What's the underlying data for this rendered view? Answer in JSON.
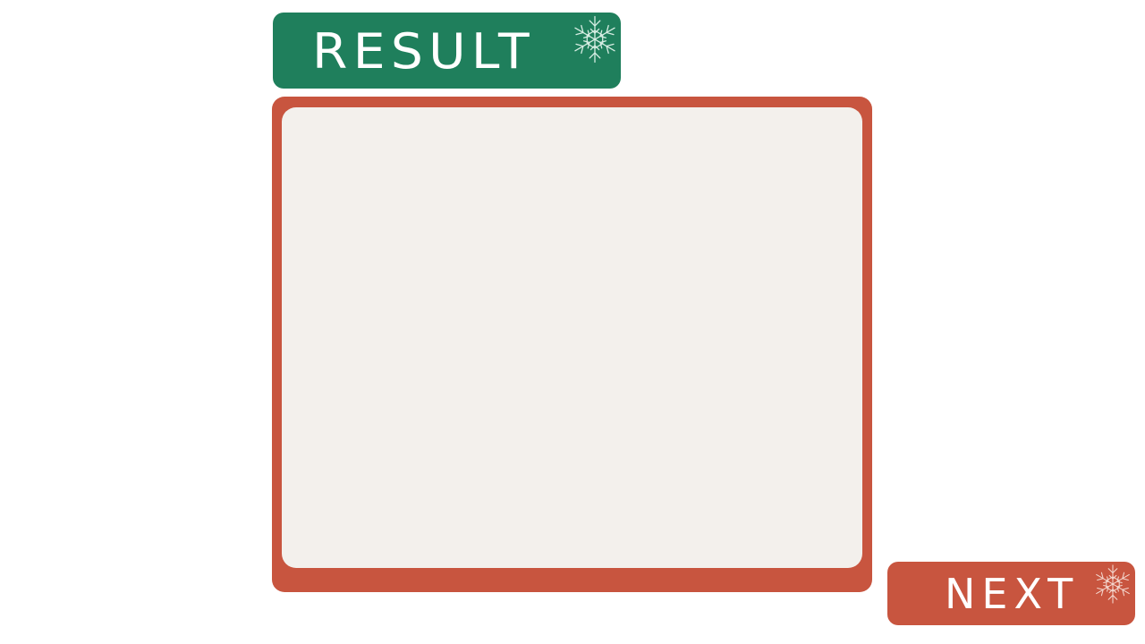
{
  "header": {
    "title": "RESULT",
    "icon": "snowflake-icon",
    "color": "#1f7f5c"
  },
  "panel": {
    "frame_color": "#c8553f",
    "content_color": "#f3f0ec"
  },
  "next_button": {
    "label": "NEXT",
    "icon": "snowflake-icon",
    "color": "#c8553f"
  }
}
